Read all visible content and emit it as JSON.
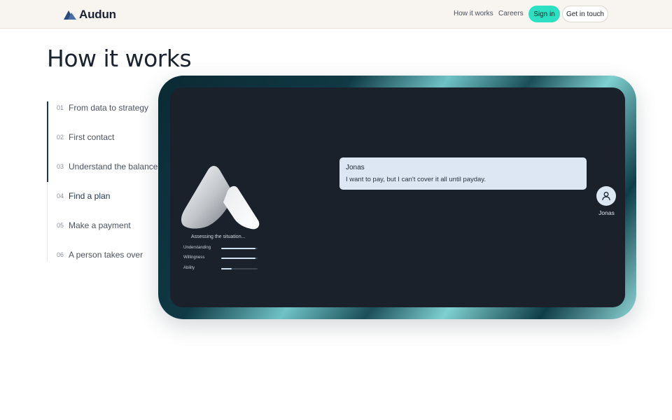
{
  "header": {
    "brand": "Audun",
    "nav": [
      {
        "label": "How it works"
      },
      {
        "label": "Careers"
      }
    ],
    "signin_label": "Sign in",
    "contact_label": "Get in touch"
  },
  "page": {
    "title": "How it works"
  },
  "steps": [
    {
      "num": "01",
      "label": "From data to strategy"
    },
    {
      "num": "02",
      "label": "First contact"
    },
    {
      "num": "03",
      "label": "Understand the balance"
    },
    {
      "num": "04",
      "label": "Find a plan",
      "active": true
    },
    {
      "num": "05",
      "label": "Make a payment"
    },
    {
      "num": "06",
      "label": "A person takes over"
    }
  ],
  "assistant": {
    "status": "Assessing the situation...",
    "metrics": [
      {
        "label": "Understanding",
        "level": 0.95
      },
      {
        "label": "Willingness",
        "level": 0.95
      },
      {
        "label": "Ability",
        "level": 0.28
      }
    ]
  },
  "chat": {
    "sender": "Jonas",
    "message": "I want to pay, but I can't cover it all until payday.",
    "avatar_name": "Jonas"
  },
  "colors": {
    "accent": "#2de0c4",
    "navy": "#1d3654",
    "screen": "#1a212b",
    "bubble": "#dde7f3"
  },
  "icons": {
    "logo": "mountain-logo-icon",
    "brand_mark": "mountain-mark-icon",
    "avatar": "user-icon"
  }
}
